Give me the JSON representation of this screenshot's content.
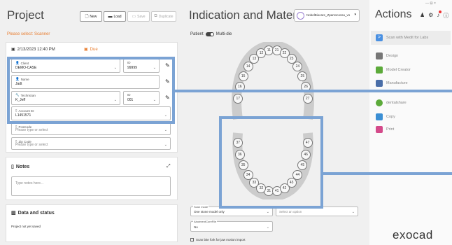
{
  "project": {
    "title": "Project",
    "buttons": {
      "new": "New",
      "load": "Load",
      "save": "Save",
      "duplicate": "Duplicate"
    },
    "please_select": "Please select: Scanner",
    "date": "2/13/2023 12:40 PM",
    "due": "Due",
    "client": {
      "label": "Client",
      "value": "DEMO-CASE",
      "id_label": "ID",
      "id_value": "99999"
    },
    "name": {
      "label": "Name",
      "value": "Jadt"
    },
    "technician": {
      "label": "Technician",
      "value": "K_Jeff",
      "id_label": "ID",
      "id_value": "001"
    },
    "account": {
      "label": "Account ID",
      "value": "L1451571"
    },
    "postcode": {
      "label": "Postcode",
      "placeholder": "Please type or select"
    },
    "zip": {
      "label": "Zip Code",
      "placeholder": "Please type or select"
    },
    "notes": {
      "title": "Notes",
      "placeholder": "Type notes here..."
    },
    "data_status": {
      "title": "Data and status",
      "status": "Project not yet saved"
    }
  },
  "indication": {
    "title": "Indication and Materials",
    "material": "NobelBiocare_Zpamscossu_v1",
    "patient_label": "Patient",
    "multidie": "Multi-die",
    "teeth_upper": [
      "11",
      "12",
      "13",
      "14",
      "15",
      "16",
      "17",
      "21",
      "22",
      "23",
      "24",
      "25",
      "26",
      "27"
    ],
    "teeth_lower": [
      "31",
      "32",
      "33",
      "34",
      "35",
      "36",
      "37",
      "41",
      "42",
      "43",
      "44",
      "45",
      "46",
      "47"
    ],
    "scan_mode": {
      "label": "Scan mode",
      "value": "One stone model only"
    },
    "select_option": "Select an option",
    "abutment": {
      "label": "AbutmentCoreFile",
      "value": "No"
    },
    "scan_bite": "Scan bite fork for jaw motion import"
  },
  "actions": {
    "title": "Actions",
    "items": [
      "Scan with Medit for Labs",
      "Design",
      "Model Creator",
      "Manufacture",
      "dentalshare",
      "Copy",
      "Print"
    ],
    "brand": "exocad",
    "window_controls": "— ⊟ ×"
  },
  "colors": {
    "accent": "#7ba3d4",
    "orange": "#e87c2e"
  }
}
